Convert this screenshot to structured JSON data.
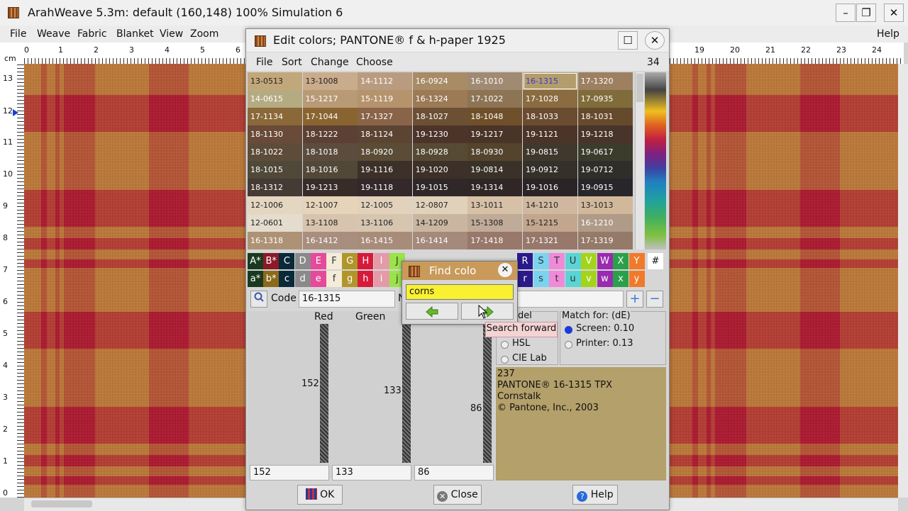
{
  "app": {
    "title": "ArahWeave 5.3m: default (160,148) 100% Simulation 6"
  },
  "menubar": {
    "items": [
      "File",
      "Weave",
      "Fabric",
      "Blanket",
      "View",
      "Zoom"
    ],
    "help": "Help"
  },
  "ruler": {
    "top": [
      {
        "label": "0"
      },
      {
        "label": "1"
      },
      {
        "label": "2"
      },
      {
        "label": "3"
      },
      {
        "label": "4"
      },
      {
        "label": "5"
      },
      {
        "label": "6"
      },
      {
        "label": "19"
      },
      {
        "label": "20"
      },
      {
        "label": "21"
      },
      {
        "label": "22"
      },
      {
        "label": "23"
      },
      {
        "label": "24"
      }
    ],
    "left": [
      "13",
      "12",
      "11",
      "10",
      "9",
      "8",
      "7",
      "6",
      "5",
      "4",
      "3",
      "2",
      "1",
      "0"
    ],
    "unit": "cm"
  },
  "dialog": {
    "title": "Edit colors; PANTONE® f & h-paper 1925",
    "menu": [
      "File",
      "Sort",
      "Change",
      "Choose"
    ],
    "count": "34",
    "swatches": [
      [
        {
          "c": "13-0513",
          "bg": "#c2a77a"
        },
        {
          "c": "13-1008",
          "bg": "#c9ac8c"
        },
        {
          "c": "14-1112",
          "bg": "#b99c80"
        },
        {
          "c": "16-0924",
          "bg": "#a88c66"
        },
        {
          "c": "16-1010",
          "bg": "#a08a72"
        },
        {
          "c": "16-1315",
          "bg": "#b39d6c"
        },
        {
          "c": "17-1320",
          "bg": "#9c8060"
        }
      ],
      [
        {
          "c": "14-0615",
          "bg": "#b5ab82"
        },
        {
          "c": "15-1217",
          "bg": "#b89a76"
        },
        {
          "c": "15-1119",
          "bg": "#b5936c"
        },
        {
          "c": "16-1324",
          "bg": "#9c7a56"
        },
        {
          "c": "17-1022",
          "bg": "#8c7454"
        },
        {
          "c": "17-1028",
          "bg": "#8a6c40"
        },
        {
          "c": "17-0935",
          "bg": "#806c3a"
        }
      ],
      [
        {
          "c": "17-1134",
          "bg": "#8a6838"
        },
        {
          "c": "17-1044",
          "bg": "#8a6430"
        },
        {
          "c": "17-1327",
          "bg": "#8a6448"
        },
        {
          "c": "18-1027",
          "bg": "#6c5034"
        },
        {
          "c": "18-1048",
          "bg": "#70502a"
        },
        {
          "c": "18-1033",
          "bg": "#6a4c30"
        },
        {
          "c": "18-1031",
          "bg": "#664a2c"
        }
      ],
      [
        {
          "c": "18-1130",
          "bg": "#6a4a38"
        },
        {
          "c": "18-1222",
          "bg": "#5c4034"
        },
        {
          "c": "18-1124",
          "bg": "#5c4432"
        },
        {
          "c": "19-1230",
          "bg": "#4c342a"
        },
        {
          "c": "19-1217",
          "bg": "#4a3428"
        },
        {
          "c": "19-1121",
          "bg": "#4c3428"
        },
        {
          "c": "19-1218",
          "bg": "#48342a"
        }
      ],
      [
        {
          "c": "18-1022",
          "bg": "#5e4c3a"
        },
        {
          "c": "18-1018",
          "bg": "#5c4c3e"
        },
        {
          "c": "18-0920",
          "bg": "#5a4c36"
        },
        {
          "c": "18-0928",
          "bg": "#564a34"
        },
        {
          "c": "18-0930",
          "bg": "#54442e"
        },
        {
          "c": "19-0815",
          "bg": "#40382c"
        },
        {
          "c": "19-0617",
          "bg": "#3c3c2c"
        }
      ],
      [
        {
          "c": "18-1015",
          "bg": "#504838"
        },
        {
          "c": "18-1016",
          "bg": "#524838"
        },
        {
          "c": "19-1116",
          "bg": "#3c3028"
        },
        {
          "c": "19-1020",
          "bg": "#3c3028"
        },
        {
          "c": "19-0814",
          "bg": "#3a3228"
        },
        {
          "c": "19-0912",
          "bg": "#34302a"
        },
        {
          "c": "19-0712",
          "bg": "#302e2a"
        }
      ],
      [
        {
          "c": "18-1312",
          "bg": "#463a34"
        },
        {
          "c": "19-1213",
          "bg": "#382c28"
        },
        {
          "c": "19-1118",
          "bg": "#34282a"
        },
        {
          "c": "19-1015",
          "bg": "#302828"
        },
        {
          "c": "19-1314",
          "bg": "#302626"
        },
        {
          "c": "19-1016",
          "bg": "#2a2426"
        },
        {
          "c": "19-0915",
          "bg": "#28262a"
        }
      ],
      [
        {
          "c": "12-1006",
          "bg": "#e4d6c0"
        },
        {
          "c": "12-1007",
          "bg": "#e6d4ba"
        },
        {
          "c": "12-1005",
          "bg": "#e2d2bc"
        },
        {
          "c": "12-0807",
          "bg": "#e0d2ba"
        },
        {
          "c": "13-1011",
          "bg": "#d6c0a6"
        },
        {
          "c": "14-1210",
          "bg": "#d0b8a0"
        },
        {
          "c": "13-1013",
          "bg": "#d2b89a"
        }
      ],
      [
        {
          "c": "12-0601",
          "bg": "#e4dccc"
        },
        {
          "c": "13-1108",
          "bg": "#d8c4ae"
        },
        {
          "c": "13-1106",
          "bg": "#d6c6b0"
        },
        {
          "c": "14-1209",
          "bg": "#cab6a0"
        },
        {
          "c": "15-1308",
          "bg": "#c0aa98"
        },
        {
          "c": "15-1215",
          "bg": "#c2a68e"
        },
        {
          "c": "16-1210",
          "bg": "#b09a88"
        }
      ],
      [
        {
          "c": "16-1318",
          "bg": "#ae9276"
        },
        {
          "c": "16-1412",
          "bg": "#a88e7e"
        },
        {
          "c": "16-1415",
          "bg": "#a88c7a"
        },
        {
          "c": "16-1414",
          "bg": "#a48a7a"
        },
        {
          "c": "17-1418",
          "bg": "#98786a"
        },
        {
          "c": "17-1321",
          "bg": "#98786a"
        },
        {
          "c": "17-1319",
          "bg": "#947a68"
        }
      ]
    ],
    "selected_code": "16-1315",
    "keys_upper": [
      {
        "k": "A*",
        "bg": "#1a3a20",
        "fg": "#fff"
      },
      {
        "k": "B*",
        "bg": "#8a1a2a",
        "fg": "#fff"
      },
      {
        "k": "C",
        "bg": "#0a2a3a",
        "fg": "#fff"
      },
      {
        "k": "D",
        "bg": "#8a8a8a",
        "fg": "#fff"
      },
      {
        "k": "E",
        "bg": "#e64a9a",
        "fg": "#fff"
      },
      {
        "k": "F",
        "bg": "#f4ecd8",
        "fg": "#333"
      },
      {
        "k": "G",
        "bg": "#b0962a",
        "fg": "#fff"
      },
      {
        "k": "H",
        "bg": "#d81a3a",
        "fg": "#fff"
      },
      {
        "k": "I",
        "bg": "#e49aa8",
        "fg": "#fff"
      },
      {
        "k": "J",
        "bg": "#9ae44a",
        "fg": "#333"
      },
      {
        "k": "R",
        "bg": "#2a1a8a",
        "fg": "#fff"
      },
      {
        "k": "S",
        "bg": "#7ad4f0",
        "fg": "#333"
      },
      {
        "k": "T",
        "bg": "#f08ad8",
        "fg": "#333"
      },
      {
        "k": "U",
        "bg": "#5ad4d4",
        "fg": "#333"
      },
      {
        "k": "V",
        "bg": "#a4d41a",
        "fg": "#fff"
      },
      {
        "k": "W",
        "bg": "#9a2ab0",
        "fg": "#fff"
      },
      {
        "k": "X",
        "bg": "#2aa04a",
        "fg": "#fff"
      },
      {
        "k": "Y",
        "bg": "#f07a2a",
        "fg": "#fff"
      }
    ],
    "keys_lower": [
      {
        "k": "a*",
        "bg": "#1a3a20",
        "fg": "#fff"
      },
      {
        "k": "b*",
        "bg": "#8a6a1a",
        "fg": "#fff"
      },
      {
        "k": "c",
        "bg": "#0a2a3a",
        "fg": "#fff"
      },
      {
        "k": "d",
        "bg": "#8a8a8a",
        "fg": "#fff"
      },
      {
        "k": "e",
        "bg": "#e64a9a",
        "fg": "#fff"
      },
      {
        "k": "f",
        "bg": "#f4ecd8",
        "fg": "#333"
      },
      {
        "k": "g",
        "bg": "#b0962a",
        "fg": "#fff"
      },
      {
        "k": "h",
        "bg": "#d81a3a",
        "fg": "#fff"
      },
      {
        "k": "i",
        "bg": "#e49aa8",
        "fg": "#fff"
      },
      {
        "k": "j",
        "bg": "#9ae44a",
        "fg": "#333"
      },
      {
        "k": "r",
        "bg": "#2a1a8a",
        "fg": "#fff"
      },
      {
        "k": "s",
        "bg": "#7ad4f0",
        "fg": "#333"
      },
      {
        "k": "t",
        "bg": "#f08ad8",
        "fg": "#333"
      },
      {
        "k": "u",
        "bg": "#5ad4d4",
        "fg": "#333"
      },
      {
        "k": "v",
        "bg": "#a4d41a",
        "fg": "#fff"
      },
      {
        "k": "w",
        "bg": "#9a2ab0",
        "fg": "#fff"
      },
      {
        "k": "x",
        "bg": "#2aa04a",
        "fg": "#fff"
      },
      {
        "k": "y",
        "bg": "#f07a2a",
        "fg": "#fff"
      }
    ],
    "hash": "#",
    "code_label": "Code",
    "code_value": "16-1315",
    "code_n": "N",
    "channels": {
      "red_label": "Red",
      "green_label": "Green",
      "red": "152",
      "green": "133",
      "blue": "86"
    },
    "model": {
      "label": "del",
      "hsl": "HSL",
      "cielab": "CIE Lab"
    },
    "match": {
      "label": "Match for: (dE)",
      "screen": "Screen: 0.10",
      "printer": "Printer: 0.13"
    },
    "info": {
      "num": "237",
      "name": "PANTONE® 16-1315 TPX",
      "desc": "Cornstalk",
      "copy": "© Pantone, Inc., 2003",
      "bg": "#b3a06a"
    },
    "buttons": {
      "ok": "OK",
      "close": "Close",
      "help": "Help"
    }
  },
  "find": {
    "title": "Find colo",
    "query": "corns",
    "tooltip": "Search forward"
  }
}
